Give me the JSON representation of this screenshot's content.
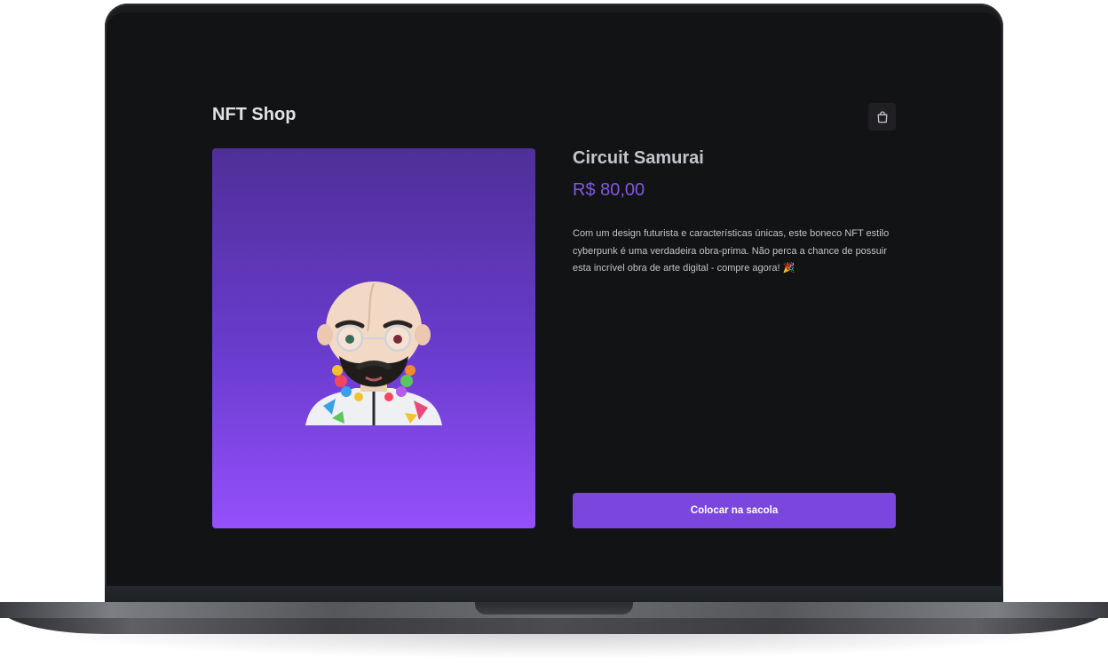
{
  "header": {
    "title": "NFT Shop",
    "bag_icon": "shopping-bag-icon"
  },
  "product": {
    "name": "Circuit Samurai",
    "price": "R$ 80,00",
    "description": "Com um design futurista e características únicas, este boneco NFT estilo cyberpunk é uma verdadeira obra-prima. Não perca a chance de possuir esta incrível obra de arte digital - compre agora! 🎉",
    "add_button_label": "Colocar na sacola"
  },
  "colors": {
    "background": "#121314",
    "accent": "#8257e5",
    "button": "#7a46dd",
    "text": "#c4c4cc",
    "title": "#e1e1e6",
    "image_gradient_top": "#4f2f98",
    "image_gradient_bottom": "#9550fb"
  }
}
